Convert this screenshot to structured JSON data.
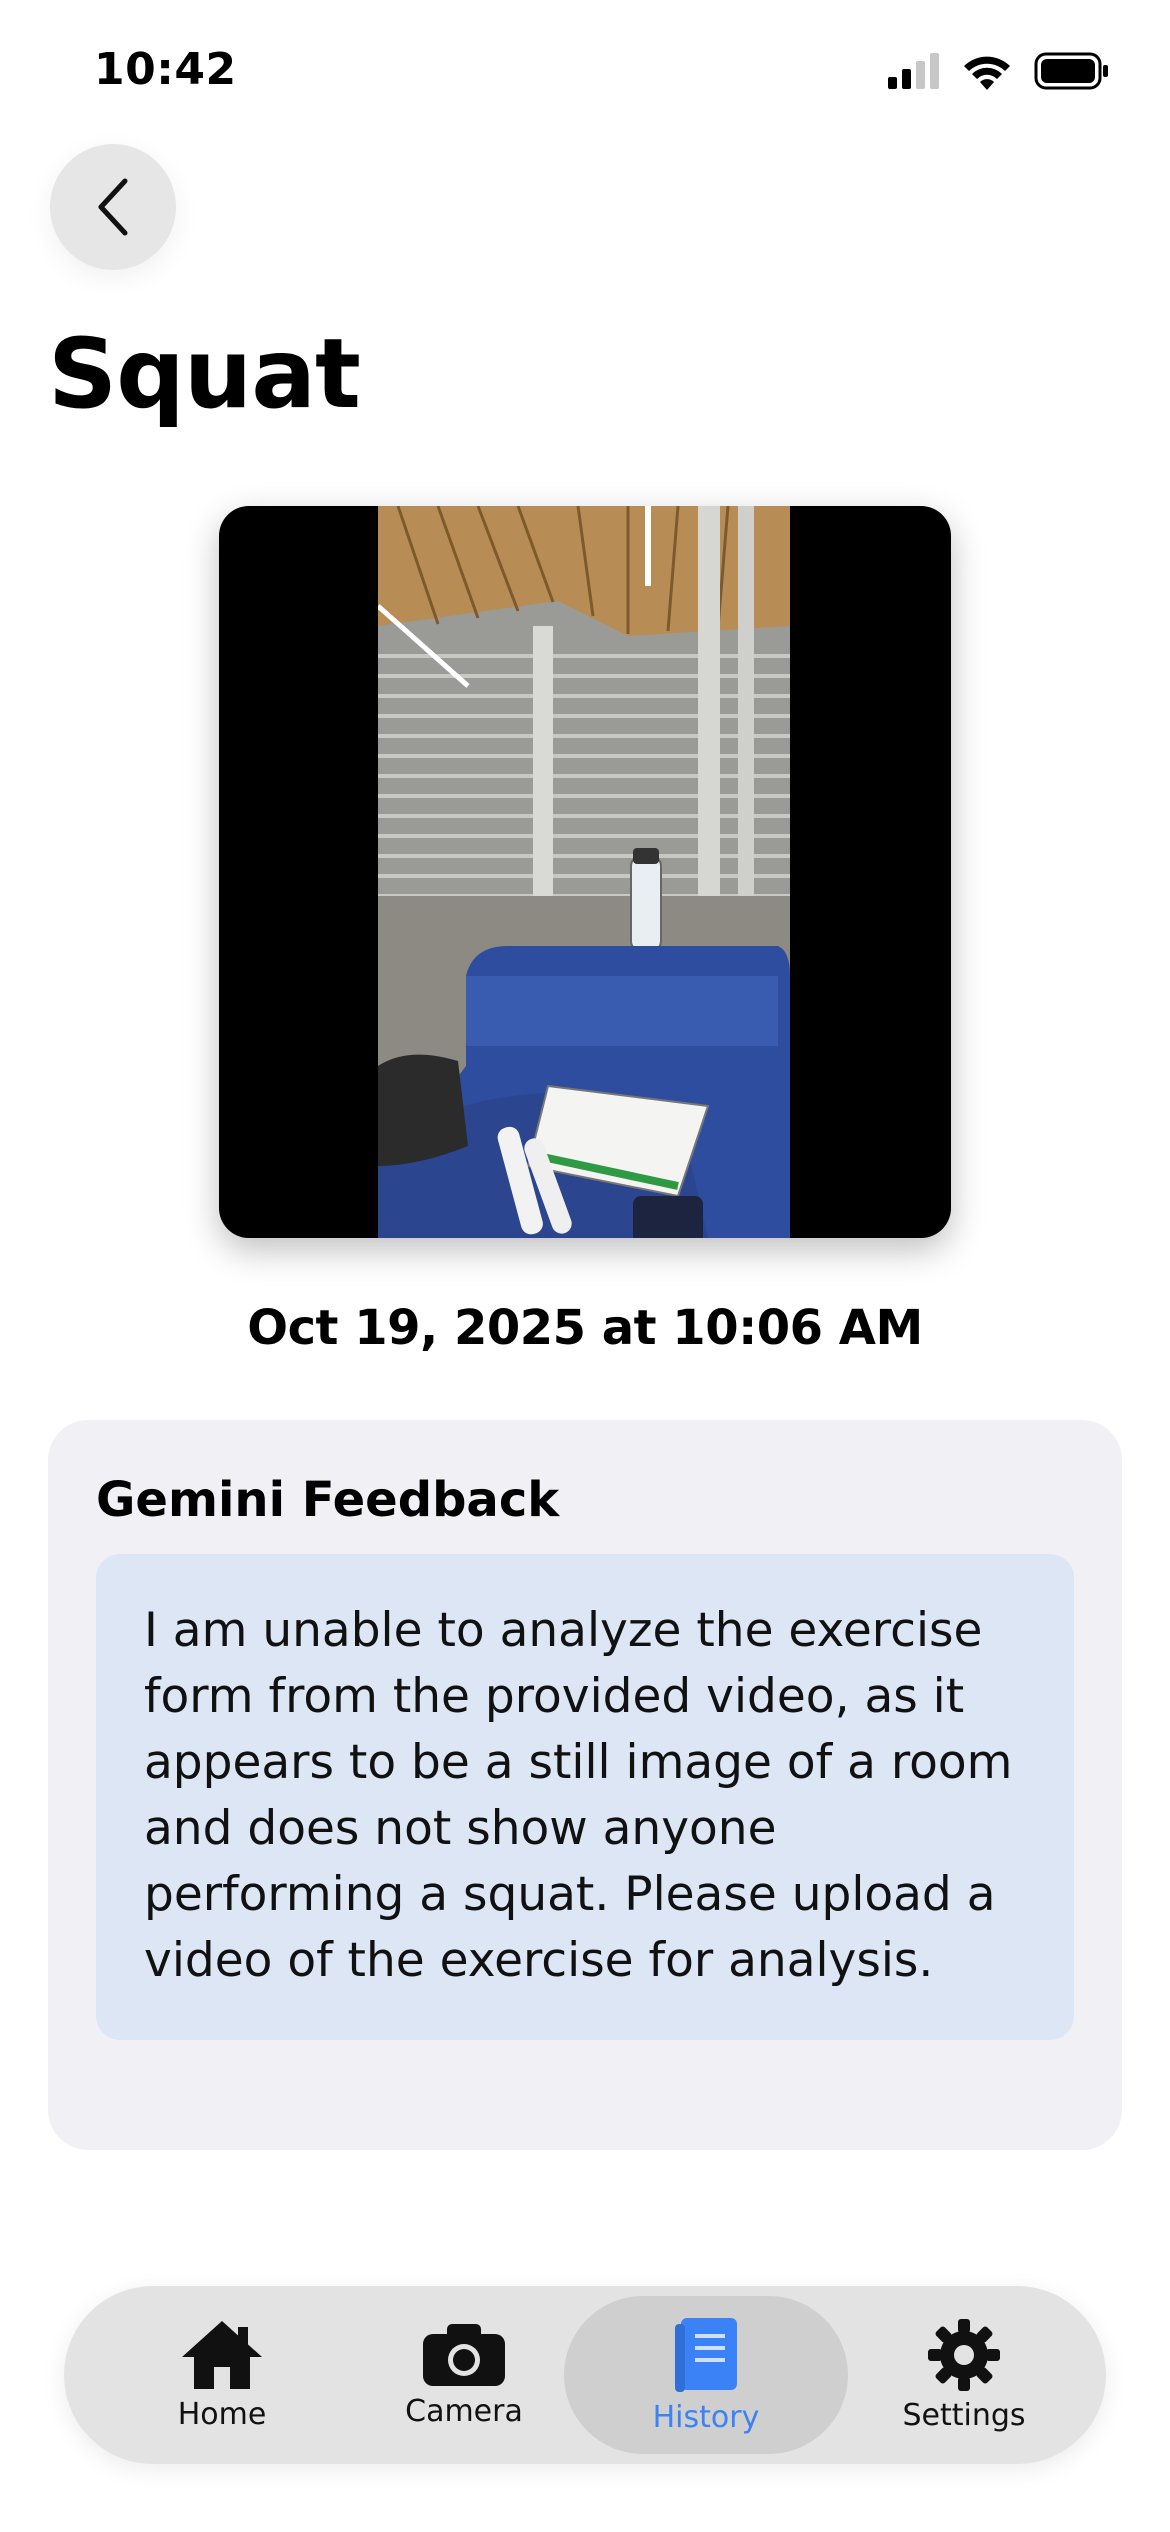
{
  "status_bar": {
    "time": "10:42"
  },
  "header": {
    "title": "Squat"
  },
  "video": {
    "timestamp": "Oct 19, 2025 at 10:06 AM"
  },
  "feedback": {
    "title": "Gemini Feedback",
    "text": "I am unable to analyze the exercise form from the provided video, as it appears to be a still image of a room and does not show anyone performing a squat. Please upload a video of the exercise for analysis."
  },
  "tab_bar": {
    "tabs": [
      {
        "label": "Home",
        "icon": "house-icon"
      },
      {
        "label": "Camera",
        "icon": "camera-icon"
      },
      {
        "label": "History",
        "icon": "book-icon",
        "active": true
      },
      {
        "label": "Settings",
        "icon": "gear-icon"
      }
    ]
  },
  "colors": {
    "accent": "#3b82f6",
    "feedback_card_bg": "#f1f1f5",
    "feedback_box_bg": "#dce6f4",
    "tab_bar_bg": "#e3e3e3"
  }
}
